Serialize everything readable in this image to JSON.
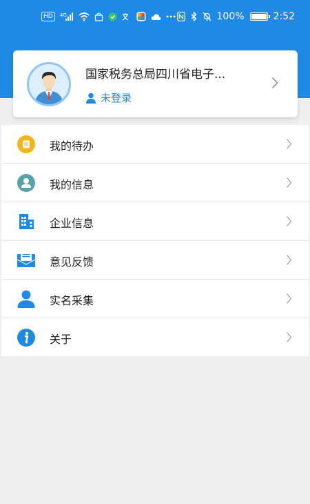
{
  "status_bar": {
    "network_badge": "HD",
    "signal_label": "4G",
    "battery_percent": "100%",
    "battery_level": 1.0,
    "time": "2:52"
  },
  "profile": {
    "org_name": "国家税务总局四川省电子...",
    "login_status": "未登录",
    "avatar_icon": "user-avatar-icon"
  },
  "menu": {
    "items": [
      {
        "label": "我的待办",
        "icon": "todo-icon",
        "color": "#f2b619"
      },
      {
        "label": "我的信息",
        "icon": "person-circle-icon",
        "color": "#59a3a8"
      },
      {
        "label": "企业信息",
        "icon": "building-icon",
        "color": "#1f8ae6"
      },
      {
        "label": "意见反馈",
        "icon": "mail-icon",
        "color": "#1f8ae6"
      },
      {
        "label": "实名采集",
        "icon": "person-icon",
        "color": "#1f8ae6"
      },
      {
        "label": "关于",
        "icon": "info-icon",
        "color": "#1f8ae6"
      }
    ]
  },
  "colors": {
    "brand": "#1f8ae6",
    "background": "#efefef"
  }
}
